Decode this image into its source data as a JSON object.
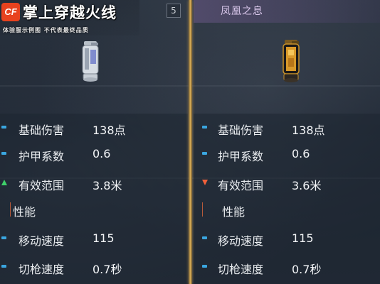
{
  "logo": {
    "mark": "CF",
    "title": "掌上穿越火线",
    "subtitle": "体验服示例图 不代表最终品质"
  },
  "left": {
    "count_badge": "5",
    "stats": [
      {
        "label": "基础伤害",
        "value": "138点",
        "marker": "neutral"
      },
      {
        "label": "护甲系数",
        "value": "0.6",
        "marker": "neutral"
      },
      {
        "label": "有效范围",
        "value": "3.8米",
        "marker": "up"
      }
    ],
    "section_title": "性能",
    "perf": [
      {
        "label": "移动速度",
        "value": "115",
        "marker": "neutral"
      },
      {
        "label": "切枪速度",
        "value": "0.7秒",
        "marker": "neutral"
      }
    ]
  },
  "right": {
    "weapon_name": "凤凰之息",
    "stats": [
      {
        "label": "基础伤害",
        "value": "138点",
        "marker": "neutral"
      },
      {
        "label": "护甲系数",
        "value": "0.6",
        "marker": "neutral"
      },
      {
        "label": "有效范围",
        "value": "3.6米",
        "marker": "down"
      }
    ],
    "section_title": "性能",
    "perf": [
      {
        "label": "移动速度",
        "value": "115",
        "marker": "neutral"
      },
      {
        "label": "切枪速度",
        "value": "0.7秒",
        "marker": "neutral"
      }
    ]
  },
  "colors": {
    "accent_gold": "#e0b45a",
    "marker_blue": "#3aa6e0",
    "marker_up": "#3fd06a",
    "marker_down": "#f0603a",
    "logo_red": "#e8421e"
  }
}
